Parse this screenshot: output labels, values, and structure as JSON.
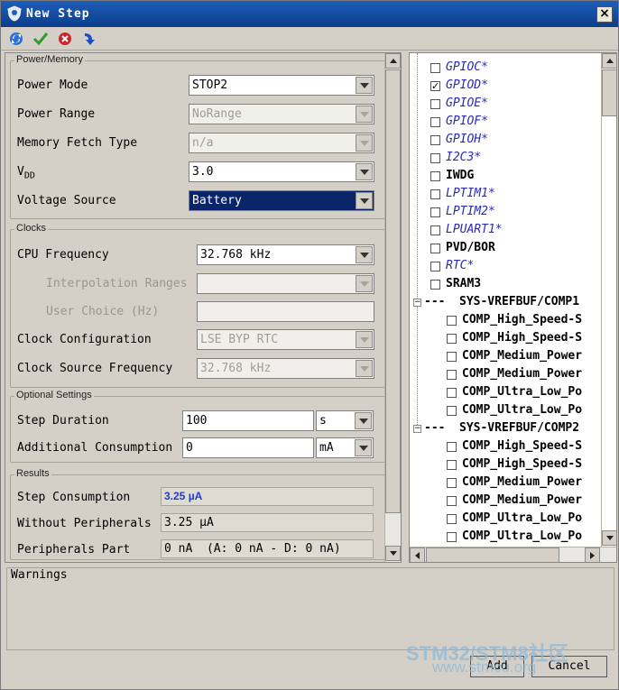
{
  "window": {
    "title": "New Step",
    "close_label": "×"
  },
  "toolbar": {
    "icons": [
      "refresh-icon",
      "check-icon",
      "cancel-icon",
      "import-icon"
    ]
  },
  "power_memory": {
    "legend": "Power/Memory",
    "power_mode": {
      "label": "Power Mode",
      "value": "STOP2"
    },
    "power_range": {
      "label": "Power Range",
      "value": "NoRange"
    },
    "memory_fetch_type": {
      "label": "Memory Fetch Type",
      "value": "n/a"
    },
    "vdd": {
      "label": "V",
      "label_sub": "DD",
      "value": "3.0"
    },
    "voltage_source": {
      "label": "Voltage Source",
      "value": "Battery"
    }
  },
  "clocks": {
    "legend": "Clocks",
    "cpu_frequency": {
      "label": "CPU Frequency",
      "value": "32.768 kHz"
    },
    "interpolation_ranges": {
      "label": "Interpolation Ranges",
      "value": ""
    },
    "user_choice": {
      "label": "User Choice (Hz)",
      "value": ""
    },
    "clock_configuration": {
      "label": "Clock Configuration",
      "value": "LSE BYP RTC"
    },
    "clock_source_frequency": {
      "label": "Clock Source Frequency",
      "value": "32.768 kHz"
    }
  },
  "optional_settings": {
    "legend": "Optional Settings",
    "step_duration": {
      "label": "Step Duration",
      "value": "100",
      "unit": "s"
    },
    "additional_consumption": {
      "label": "Additional Consumption",
      "value": "0",
      "unit": "mA"
    }
  },
  "results": {
    "legend": "Results",
    "step_consumption": {
      "label": "Step Consumption",
      "value": "3.25 µA"
    },
    "without_peripherals": {
      "label": "Without Peripherals",
      "value": "3.25 µA"
    },
    "peripherals_part": {
      "label": "Peripherals Part",
      "value": "0 nA  (A: 0 nA - D: 0 nA)"
    }
  },
  "peripherals_tree": {
    "items": [
      {
        "label": "GPIOC*",
        "checked": false,
        "style": "italic"
      },
      {
        "label": "GPIOD*",
        "checked": true,
        "style": "italic"
      },
      {
        "label": "GPIOE*",
        "checked": false,
        "style": "italic"
      },
      {
        "label": "GPIOF*",
        "checked": false,
        "style": "italic"
      },
      {
        "label": "GPIOH*",
        "checked": false,
        "style": "italic"
      },
      {
        "label": "I2C3*",
        "checked": false,
        "style": "italic"
      },
      {
        "label": "IWDG",
        "checked": false,
        "style": "bold"
      },
      {
        "label": "LPTIM1*",
        "checked": false,
        "style": "italic"
      },
      {
        "label": "LPTIM2*",
        "checked": false,
        "style": "italic"
      },
      {
        "label": "LPUART1*",
        "checked": false,
        "style": "italic"
      },
      {
        "label": "PVD/BOR",
        "checked": false,
        "style": "bold"
      },
      {
        "label": "RTC*",
        "checked": false,
        "style": "italic"
      },
      {
        "label": "SRAM3",
        "checked": false,
        "style": "bold"
      }
    ],
    "groups": [
      {
        "label": "SYS-VREFBUF/COMP1",
        "children": [
          "COMP_High_Speed-S",
          "COMP_High_Speed-S",
          "COMP_Medium_Power",
          "COMP_Medium_Power",
          "COMP_Ultra_Low_Po",
          "COMP_Ultra_Low_Po"
        ]
      },
      {
        "label": "SYS-VREFBUF/COMP2",
        "children": [
          "COMP_High_Speed-S",
          "COMP_High_Speed-S",
          "COMP_Medium_Power",
          "COMP_Medium_Power",
          "COMP_Ultra_Low_Po",
          "COMP_Ultra_Low_Po"
        ]
      }
    ]
  },
  "warnings": {
    "legend": "Warnings"
  },
  "buttons": {
    "add": "Add",
    "cancel": "Cancel"
  },
  "watermark": {
    "line1": "STM32/STM8社区",
    "line2": "www.stmcu.org"
  }
}
